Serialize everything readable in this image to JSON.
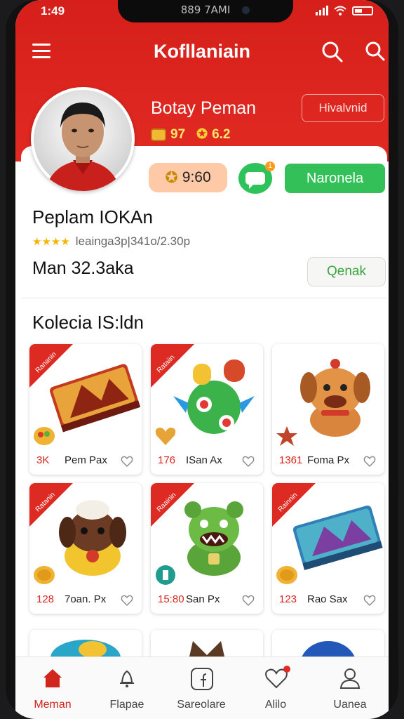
{
  "status_bar": {
    "time": "1:49",
    "carrier": "889 7AMI"
  },
  "header": {
    "title": "Kofllaniain",
    "action_label": "Hivalvnid"
  },
  "profile": {
    "name": "Botay Peman",
    "coins": "97",
    "level": "6.2",
    "coin_balance": "9:60",
    "chat_badge": "1",
    "follow_label": "Naronela",
    "username": "Peplam IOKAn",
    "rating_stars": "★★★★",
    "rating_text": "leainga3p|341o/2.30p",
    "amount": "Man 32.3aka",
    "secondary_label": "Qenak"
  },
  "collection": {
    "title": "Kolecia IS:ldn",
    "items": [
      {
        "price": "3K",
        "name": "Pem Pax",
        "ribbon": "Rananin"
      },
      {
        "price": "176",
        "name": "ISan Ax",
        "ribbon": "Rataiin"
      },
      {
        "price": "1361",
        "name": "Foma Px",
        "ribbon": ""
      },
      {
        "price": "128",
        "name": "7oan. Px",
        "ribbon": "Ratanin"
      },
      {
        "price": "15:80",
        "name": "San Px",
        "ribbon": "Raainin"
      },
      {
        "price": "123",
        "name": "Rao Sax",
        "ribbon": "Rainnin"
      }
    ]
  },
  "tabs": [
    {
      "label": "Meman",
      "icon": "home-icon"
    },
    {
      "label": "Flapae",
      "icon": "bell-icon"
    },
    {
      "label": "Sareolare",
      "icon": "square-f-icon"
    },
    {
      "label": "Alilo",
      "icon": "heart-icon"
    },
    {
      "label": "Uanea",
      "icon": "person-icon"
    }
  ],
  "colors": {
    "brand_red": "#d61f1a",
    "green": "#33c058",
    "price_red": "#d8281f"
  }
}
